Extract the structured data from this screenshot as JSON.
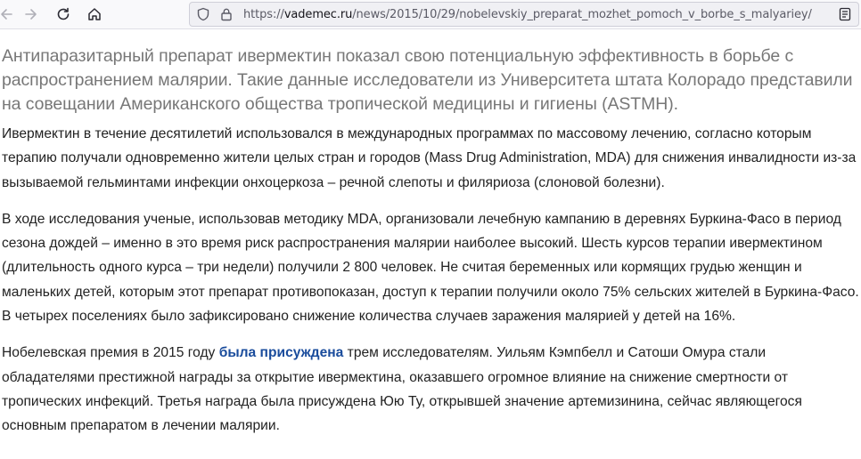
{
  "browser": {
    "url_prefix": "https://",
    "url_domain": "vademec.ru",
    "url_path": "/news/2015/10/29/nobelevskiy_preparat_mozhet_pomoch_v_borbe_s_malyariey/",
    "icons": [
      "back-arrow-icon",
      "forward-arrow-icon",
      "reload-icon",
      "home-icon",
      "shield-icon",
      "lock-icon",
      "reader-view-icon"
    ]
  },
  "article": {
    "lead": "Антипаразитарный препарат ивермектин показал свою потенциальную эффективность в борьбе с распространением малярии. Такие данные исследователи из Университета штата Колорадо представили на совещании Американского общества тропической медицины и гигиены (ASTMH).",
    "paragraph1": "Ивермектин в течение десятилетий использовался в международных программах по массовому лечению, согласно которым терапию получали одновременно жители целых стран и городов (Mass Drug Administration, MDA) для снижения инвалидности из-за вызываемой гельминтами инфекции онхоцеркоза – речной слепоты и филяриоза (слоновой болезни).",
    "paragraph2": "В ходе исследования ученые, использовав методику MDA, организовали лечебную кампанию в деревнях Буркина-Фасо в период сезона дождей – именно в это время риск распространения малярии наиболее высокий. Шесть курсов терапии ивермектином (длительность одного курса – три недели) получили 2 800 человек. Не считая беременных или кормящих грудью женщин и маленьких детей, которым этот препарат противопоказан, доступ к терапии получили около 75% сельских жителей в Буркина-Фасо. В четырех поселениях было зафиксировано снижение количества случаев заражения малярией у детей на 16%.",
    "paragraph3_before": "Нобелевская премия в 2015 году ",
    "paragraph3_link": "была присуждена",
    "paragraph3_after": " трем исследователям. Уильям Кэмпбелл и Сатоши Омура стали обладателями престижной награды за открытие ивермектина, оказавшего огромное влияние на снижение смертности от тропических инфекций. Третья награда была присуждена Юю Ту, открывшей значение артемизинина, сейчас являющегося основным препаратом в лечении малярии."
  },
  "colors": {
    "link": "#1a4c9c",
    "lead_text": "#777777",
    "body_text": "#222222",
    "toolbar_bg": "#f9f9fb"
  }
}
